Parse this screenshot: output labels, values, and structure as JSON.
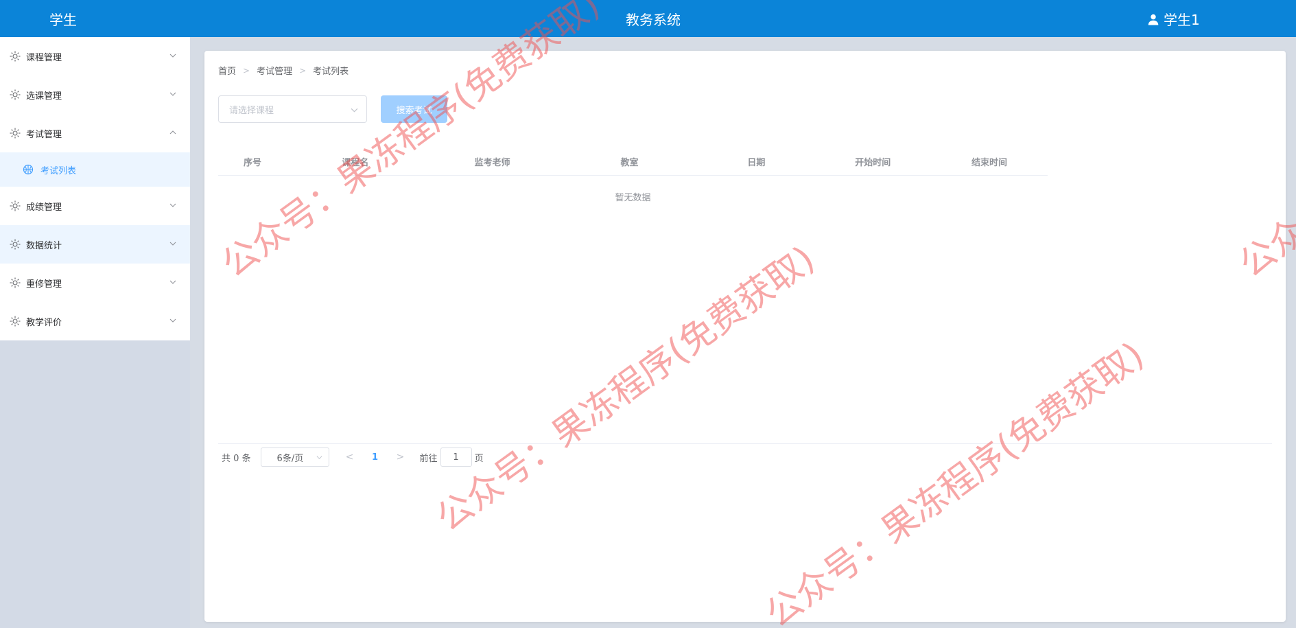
{
  "header": {
    "role": "学生",
    "title": "教务系统",
    "user": "学生1"
  },
  "sidebar": {
    "items": [
      {
        "label": "课程管理"
      },
      {
        "label": "选课管理"
      },
      {
        "label": "考试管理",
        "expanded": true,
        "children": [
          {
            "label": "考试列表",
            "active": true
          }
        ]
      },
      {
        "label": "成绩管理"
      },
      {
        "label": "数据统计"
      },
      {
        "label": "重修管理"
      },
      {
        "label": "教学评价"
      }
    ]
  },
  "breadcrumb": [
    "首页",
    "考试管理",
    "考试列表"
  ],
  "filter": {
    "course_placeholder": "请选择课程",
    "search_label": "搜索考试"
  },
  "table": {
    "headers": [
      "序号",
      "课程名",
      "监考老师",
      "教室",
      "日期",
      "开始时间",
      "结束时间"
    ],
    "empty_text": "暂无数据"
  },
  "pagination": {
    "total": "共 0 条",
    "page_size": "6条/页",
    "current_page": "1",
    "goto_label": "前往",
    "goto_value": "1",
    "goto_suffix": "页"
  },
  "watermark": "公众号：果冻程序(免费获取)",
  "colors": {
    "header_bg": "#0b84d8",
    "accent": "#409eff",
    "sidebar_bg": "#d3dae6",
    "watermark": "#f05050"
  }
}
